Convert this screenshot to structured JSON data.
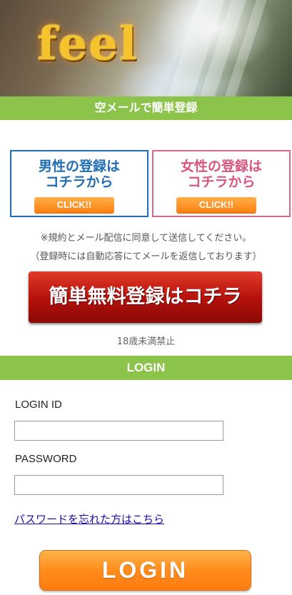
{
  "header": {
    "logo_text": "feel"
  },
  "signup": {
    "bar_title": "空メールで簡単登録",
    "male": {
      "line1": "男性の登録は",
      "line2": "コチラから",
      "button": "CLICK!!"
    },
    "female": {
      "line1": "女性の登録は",
      "line2": "コチラから",
      "button": "CLICK!!"
    },
    "note1": "※規約とメール配信に同意して送信してください。",
    "note2": "（登録時には自動応答にてメールを返信しております）",
    "register_button": "簡単無料登録はコチラ",
    "age_note": "18歳未満禁止"
  },
  "login": {
    "bar_title": "LOGIN",
    "id_label": "LOGIN ID",
    "id_value": "",
    "password_label": "PASSWORD",
    "password_value": "",
    "forgot_link": "パスワードを忘れた方はこちら",
    "button": "LOGIN"
  },
  "colors": {
    "accent_green": "#8cc34a",
    "male_blue": "#1f6db4",
    "female_pink": "#d66a8c",
    "register_red": "#b3100b",
    "login_orange": "#ff8c1c"
  }
}
